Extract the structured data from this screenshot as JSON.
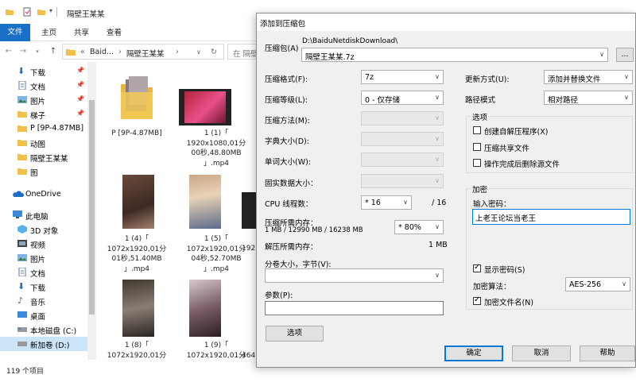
{
  "explorer": {
    "title": "隔壁王某某",
    "ribbon_tabs": [
      "文件",
      "主页",
      "共享",
      "查看"
    ],
    "address": {
      "sep": "«",
      "crumbs": [
        "Baid...",
        "隔壁王某某"
      ]
    },
    "search_placeholder": "在 隔壁",
    "sidebar": [
      {
        "label": "下载",
        "icon": "download-icon",
        "pinned": true
      },
      {
        "label": "文档",
        "icon": "document-icon",
        "pinned": true
      },
      {
        "label": "图片",
        "icon": "pictures-icon",
        "pinned": true
      },
      {
        "label": "梯子",
        "icon": "folder-icon",
        "pinned": true
      },
      {
        "label": "P [9P-4.87MB]",
        "icon": "folder-icon",
        "pinned": false
      },
      {
        "label": "动图",
        "icon": "folder-icon",
        "pinned": false
      },
      {
        "label": "隔壁王某某",
        "icon": "folder-icon",
        "pinned": false
      },
      {
        "label": "图",
        "icon": "folder-icon",
        "pinned": false
      },
      {
        "label": "OneDrive",
        "icon": "onedrive-icon",
        "pinned": false
      },
      {
        "label": "此电脑",
        "icon": "pc-icon",
        "pinned": false
      },
      {
        "label": "3D 对象",
        "icon": "3d-objects-icon",
        "pinned": false
      },
      {
        "label": "视频",
        "icon": "videos-icon",
        "pinned": false
      },
      {
        "label": "图片",
        "icon": "pictures-icon",
        "pinned": false
      },
      {
        "label": "文档",
        "icon": "document-icon",
        "pinned": false
      },
      {
        "label": "下载",
        "icon": "download-icon",
        "pinned": false
      },
      {
        "label": "音乐",
        "icon": "music-icon",
        "pinned": false
      },
      {
        "label": "桌面",
        "icon": "desktop-icon",
        "pinned": false
      },
      {
        "label": "本地磁盘 (C:)",
        "icon": "drive-icon",
        "pinned": false
      },
      {
        "label": "新加卷 (D:)",
        "icon": "drive-icon",
        "pinned": false
      }
    ],
    "files": [
      {
        "name": "P [9P-4.87MB]"
      },
      {
        "name": "1 (1)「\n1920x1080,01分\n00秒,48.80MB\n」.mp4"
      },
      {
        "name": "1 (4)「\n1072x1920,01分\n01秒,51.40MB\n」.mp4"
      },
      {
        "name": "1 (5)「\n1072x1920,01分\n04秒,52.70MB\n」.mp4"
      },
      {
        "name": "192"
      },
      {
        "name": "1 (8)「\n1072x1920,01分"
      },
      {
        "name": "1 (9)「\n1072x1920,01分"
      },
      {
        "name": "464"
      }
    ],
    "status": "119 个项目"
  },
  "dialog": {
    "title": "添加到压缩包",
    "archive_label": "压缩包(A)",
    "archive_path": "D:\\BaiduNetdiskDownload\\",
    "archive_name": "隔壁王某某.7z",
    "browse_label": "...",
    "format_label": "压缩格式(F):",
    "format_value": "7z",
    "level_label": "压缩等级(L):",
    "level_value": "0 - 仅存储",
    "method_label": "压缩方法(M):",
    "dict_label": "字典大小(D):",
    "word_label": "单词大小(W):",
    "solid_label": "固实数据大小：",
    "cpu_label": "CPU 线程数：",
    "cpu_value": "* 16",
    "cpu_total": "/ 16",
    "mem_label": "压缩所需内存：",
    "mem_detail": "1 MB / 12990 MB / 16238 MB",
    "mem_percent": "* 80%",
    "decomp_label": "解压所需内存：",
    "decomp_value": "1 MB",
    "split_label": "分卷大小，字节(V):",
    "params_label": "参数(P):",
    "options_button": "选项",
    "update_label": "更新方式(U):",
    "update_value": "添加并替换文件",
    "path_label": "路径模式",
    "path_value": "相对路径",
    "options_group": "选项",
    "opt_sfx": "创建自解压程序(X)",
    "opt_shared": "压缩共享文件",
    "opt_delete": "操作完成后删除源文件",
    "enc_group": "加密",
    "pwd_label": "输入密码：",
    "pwd_value": "上老王论坛当老王",
    "show_pwd": "显示密码(S)",
    "enc_method_label": "加密算法：",
    "enc_method_value": "AES-256",
    "enc_names": "加密文件名(N)",
    "ok": "确定",
    "cancel": "取消",
    "help": "帮助"
  }
}
